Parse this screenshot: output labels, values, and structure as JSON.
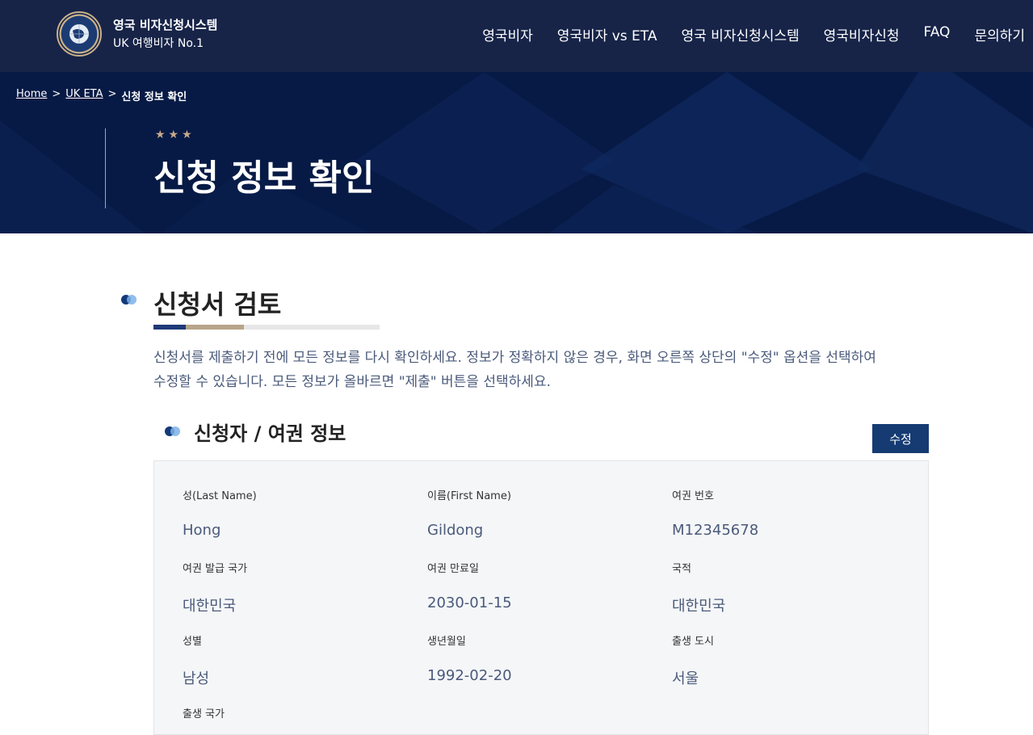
{
  "brand": {
    "line1": "영국 비자신청시스템",
    "line2": "UK 여행비자 No.1"
  },
  "nav": [
    "영국비자",
    "영국비자 vs ETA",
    "영국 비자신청시스템",
    "영국비자신청",
    "FAQ",
    "문의하기"
  ],
  "breadcrumb": {
    "home": "Home",
    "sep1": ">",
    "eta": "UK ETA",
    "sep2": ">",
    "current": "신청 정보 확인"
  },
  "hero": {
    "stars": "★★★",
    "title": "신청 정보 확인"
  },
  "section": {
    "title": "신청서 검토",
    "desc_line1": "신청서를 제출하기 전에 모든 정보를 다시 확인하세요. 정보가 정확하지 않은 경우, 화면 오른쪽 상단의 \"수정\" 옵션을 선택하여",
    "desc_line2": "수정할 수 있습니다. 모든 정보가 올바르면 \"제출\" 버튼을 선택하세요."
  },
  "applicant": {
    "title": "신청자 / 여권 정보",
    "edit_label": "수정",
    "fields": [
      {
        "label": "성(Last Name)",
        "value": "Hong"
      },
      {
        "label": "이름(First Name)",
        "value": "Gildong"
      },
      {
        "label": "여권 번호",
        "value": "M12345678"
      },
      {
        "label": "여권 발급 국가",
        "value": "대한민국"
      },
      {
        "label": "여권 만료일",
        "value": "2030-01-15"
      },
      {
        "label": "국적",
        "value": "대한민국"
      },
      {
        "label": "성별",
        "value": "남성"
      },
      {
        "label": "생년월일",
        "value": "1992-02-20"
      },
      {
        "label": "출생 도시",
        "value": "서울"
      },
      {
        "label": "출생 국가",
        "value": ""
      }
    ]
  }
}
